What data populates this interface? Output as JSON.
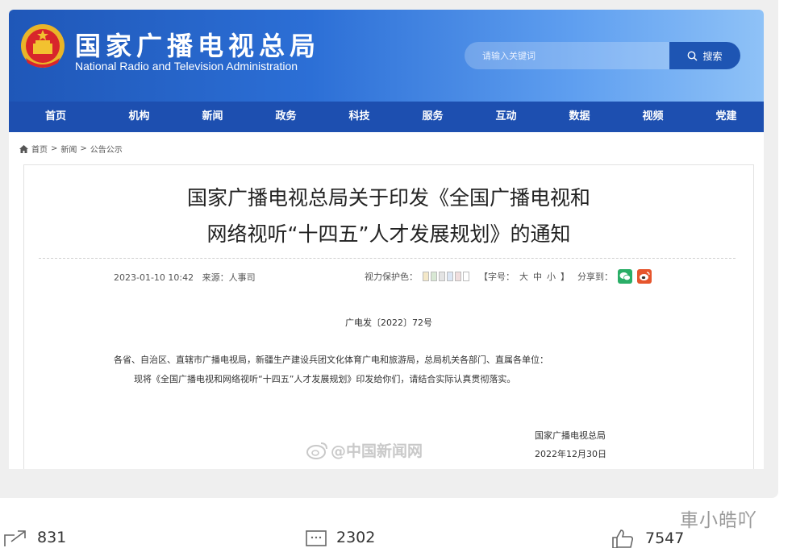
{
  "site": {
    "name_cn": "国家广播电视总局",
    "name_en": "National Radio and Television Administration"
  },
  "search": {
    "placeholder": "请输入关键词",
    "button_label": "搜索"
  },
  "nav": {
    "items": [
      "首页",
      "机构",
      "新闻",
      "政务",
      "科技",
      "服务",
      "互动",
      "数据",
      "视频",
      "党建"
    ]
  },
  "breadcrumb": {
    "items": [
      "首页",
      "新闻",
      "公告公示"
    ],
    "separator": ">"
  },
  "article": {
    "title_line1": "国家广播电视总局关于印发《全国广播电视和",
    "title_line2": "网络视听“十四五”人才发展规划》的通知",
    "datetime": "2023-01-10 10:42",
    "source_label": "来源：",
    "source": "人事司",
    "eye_protect_label": "视力保护色：",
    "font_size_label": "【字号：",
    "font_sizes": [
      "大",
      "中",
      "小"
    ],
    "font_size_close": "】",
    "share_label": "分享到：",
    "doc_number": "广电发〔2022〕72号",
    "body_line1": "各省、自治区、直辖市广播电视局，新疆生产建设兵团文化体育广电和旅游局，总局机关各部门、直属各单位：",
    "body_line2": "现将《全国广播电视和网络视听“十四五”人才发展规划》印发给你们，请结合实际认真贯彻落实。",
    "signature_org": "国家广播电视总局",
    "signature_date": "2022年12月30日"
  },
  "watermark": "@中国新闻网",
  "stats": {
    "repost_count": "831",
    "comment_count": "2302",
    "like_count": "7547"
  },
  "author_watermark": "車小皓吖",
  "colors": {
    "nav_bg": "#1d4fb0",
    "wechat": "#2aae67",
    "weibo": "#e6552d"
  }
}
